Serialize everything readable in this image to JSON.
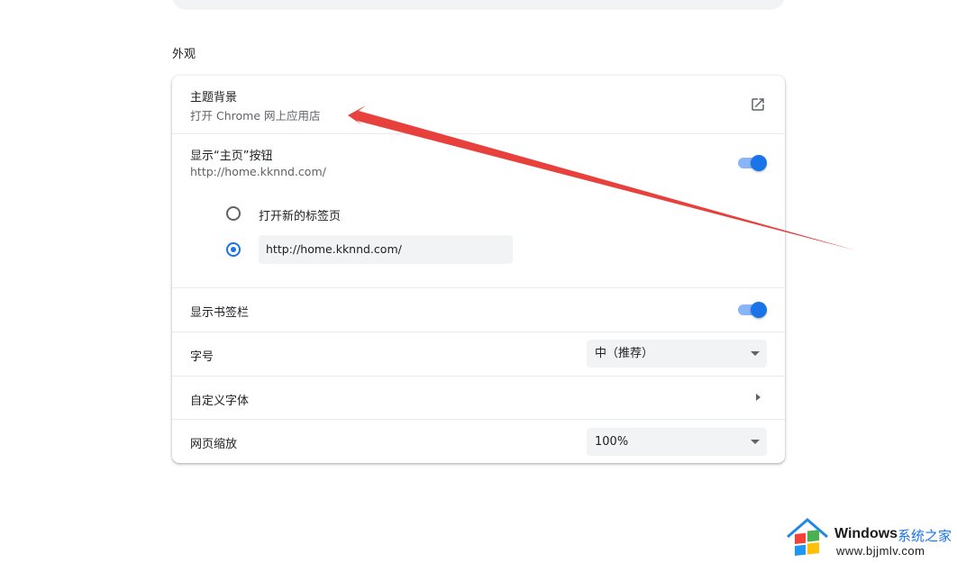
{
  "section": {
    "title": "外观"
  },
  "theme": {
    "label": "主题背景",
    "sublabel": "打开 Chrome 网上应用店",
    "icon": "open-in-new-icon"
  },
  "home_button": {
    "label": "显示“主页”按钮",
    "sublabel": "http://home.kknnd.com/",
    "enabled": true,
    "options": [
      {
        "label": "打开新的标签页",
        "checked": false
      },
      {
        "value": "http://home.kknnd.com/",
        "checked": true
      }
    ]
  },
  "bookmarks_bar": {
    "label": "显示书签栏",
    "enabled": true
  },
  "font_size": {
    "label": "字号",
    "selected": "中（推荐）"
  },
  "custom_fonts": {
    "label": "自定义字体",
    "icon": "chevron-right-icon"
  },
  "page_zoom": {
    "label": "网页缩放",
    "selected": "100%"
  },
  "colors": {
    "accent": "#1a73e8",
    "toggle_track": "#8ab4f8",
    "annotation_arrow": "#e8403d"
  },
  "watermark": {
    "brand": "Windows",
    "brand_cn": "系统之家",
    "url": "www.bjjmlv.com"
  }
}
